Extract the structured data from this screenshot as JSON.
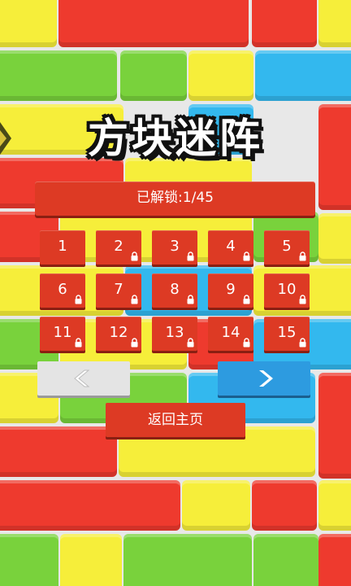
{
  "game": {
    "title": "方块迷阵",
    "unlocked_text": "已解锁:1/45",
    "unlocked_count": 1,
    "total_levels": 45
  },
  "levels": [
    {
      "label": "1",
      "locked": false
    },
    {
      "label": "2",
      "locked": true
    },
    {
      "label": "3",
      "locked": true
    },
    {
      "label": "4",
      "locked": true
    },
    {
      "label": "5",
      "locked": true
    },
    {
      "label": "6",
      "locked": true
    },
    {
      "label": "7",
      "locked": true
    },
    {
      "label": "8",
      "locked": true
    },
    {
      "label": "9",
      "locked": true
    },
    {
      "label": "10",
      "locked": true
    },
    {
      "label": "11",
      "locked": true
    },
    {
      "label": "12",
      "locked": true
    },
    {
      "label": "13",
      "locked": true
    },
    {
      "label": "14",
      "locked": true
    },
    {
      "label": "15",
      "locked": true
    }
  ],
  "nav": {
    "prev_icon": "chevron-left-icon",
    "next_icon": "chevron-right-icon"
  },
  "home_button": "返回主页",
  "colors": {
    "red": "#ee3a2e",
    "yellow": "#f6ee3a",
    "green": "#79d23c",
    "blue": "#33b8ee",
    "button_red": "#dd3a24",
    "next_blue": "#2d9be0",
    "prev_gray": "#e4e4e4"
  }
}
